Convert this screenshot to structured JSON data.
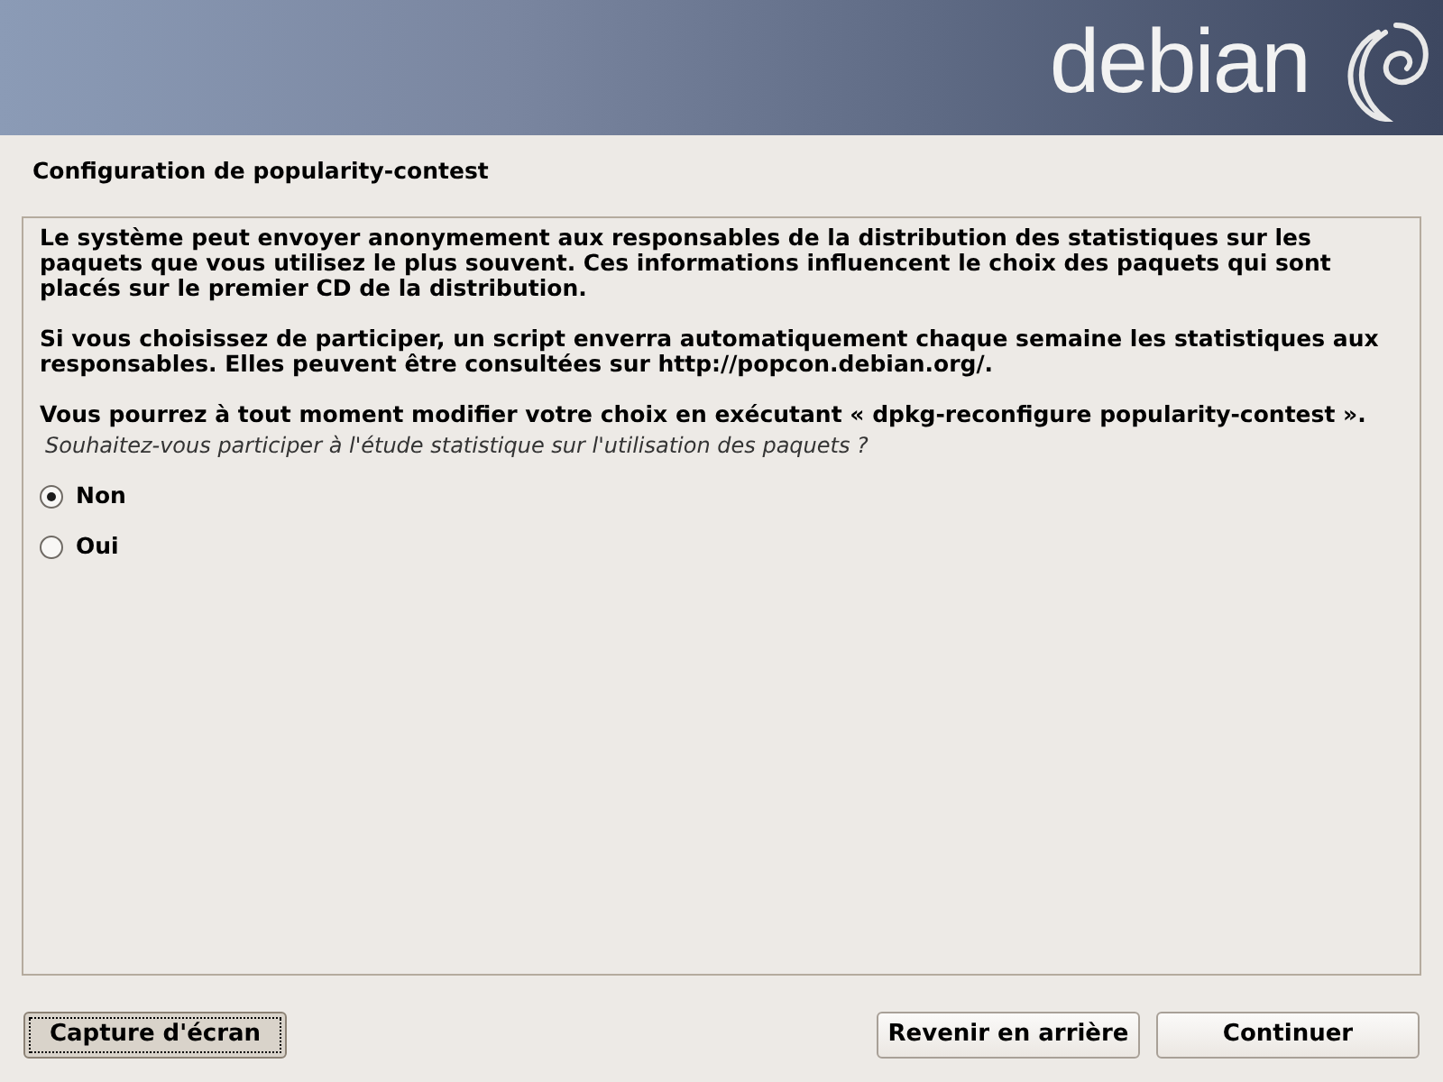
{
  "banner": {
    "logo_text": "debian"
  },
  "title": "Configuration de popularity-contest",
  "paragraphs": [
    "Le système peut envoyer anonymement aux responsables de la distribution des statistiques sur les paquets que vous utilisez le plus souvent. Ces informations influencent le choix des paquets qui sont placés sur le premier CD de la distribution.",
    "Si vous choisissez de participer, un script enverra automatiquement chaque semaine les statistiques aux responsables. Elles peuvent être consultées sur http://popcon.debian.org/.",
    "Vous pourrez à tout moment modifier votre choix en exécutant « dpkg-reconfigure popularity-contest »."
  ],
  "question": "Souhaitez-vous participer à l'étude statistique sur l'utilisation des paquets ?",
  "options": [
    {
      "label": "Non",
      "selected": true
    },
    {
      "label": "Oui",
      "selected": false
    }
  ],
  "buttons": [
    {
      "label": "Capture d'écran",
      "focused": true
    },
    {
      "label": "Revenir en arrière",
      "focused": false
    },
    {
      "label": "Continuer",
      "focused": false
    }
  ]
}
